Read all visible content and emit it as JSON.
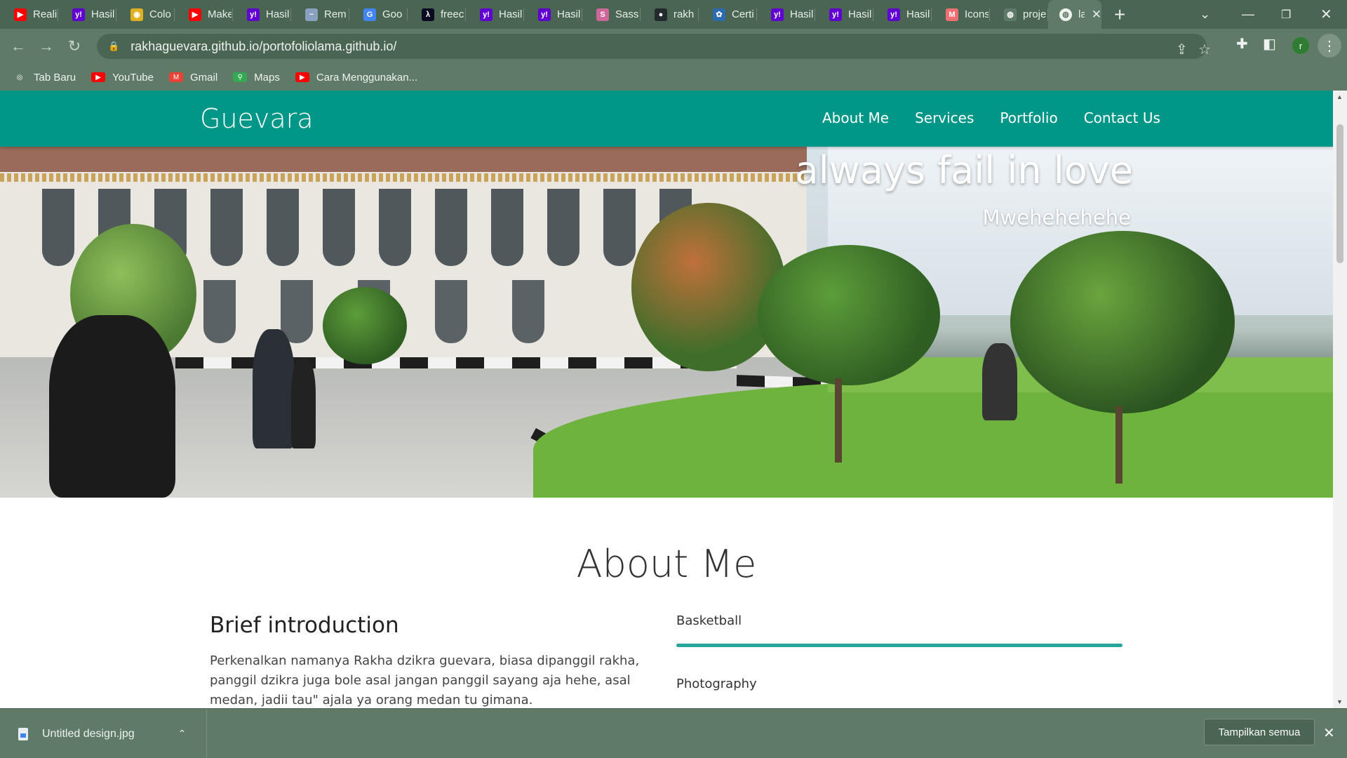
{
  "browser": {
    "tabs": [
      {
        "title": "Reali",
        "icon": "youtube-icon",
        "color": "#ff0000",
        "glyph": "▶"
      },
      {
        "title": "Hasil",
        "icon": "yahoo-icon",
        "color": "#6001d2",
        "glyph": "y!"
      },
      {
        "title": "Colo",
        "icon": "colorpicker-icon",
        "color": "#e0b020",
        "glyph": "◉"
      },
      {
        "title": "Make",
        "icon": "youtube-icon",
        "color": "#ff0000",
        "glyph": "▶"
      },
      {
        "title": "Hasil",
        "icon": "yahoo-icon",
        "color": "#6001d2",
        "glyph": "y!"
      },
      {
        "title": "Rem",
        "icon": "remove-icon",
        "color": "#8aa0c0",
        "glyph": "~"
      },
      {
        "title": "Goo",
        "icon": "google-translate-icon",
        "color": "#4285f4",
        "glyph": "G"
      },
      {
        "title": "freec",
        "icon": "freecodecamp-icon",
        "color": "#0a0a23",
        "glyph": "λ"
      },
      {
        "title": "Hasil",
        "icon": "yahoo-icon",
        "color": "#6001d2",
        "glyph": "y!"
      },
      {
        "title": "Hasil",
        "icon": "yahoo-icon",
        "color": "#6001d2",
        "glyph": "y!"
      },
      {
        "title": "Sass",
        "icon": "sass-icon",
        "color": "#cd6799",
        "glyph": "S"
      },
      {
        "title": "rakh",
        "icon": "github-icon",
        "color": "#24292e",
        "glyph": "●"
      },
      {
        "title": "Certi",
        "icon": "certificate-icon",
        "color": "#2b6cb0",
        "glyph": "✿"
      },
      {
        "title": "Hasil",
        "icon": "yahoo-icon",
        "color": "#6001d2",
        "glyph": "y!"
      },
      {
        "title": "Hasil",
        "icon": "yahoo-icon",
        "color": "#6001d2",
        "glyph": "y!"
      },
      {
        "title": "Hasil",
        "icon": "yahoo-icon",
        "color": "#6001d2",
        "glyph": "y!"
      },
      {
        "title": "Icons",
        "icon": "materialize-icon",
        "color": "#ee6e73",
        "glyph": "M"
      },
      {
        "title": "proje",
        "icon": "globe-icon",
        "color": "#5f7a66",
        "glyph": "◍"
      }
    ],
    "active_tab": {
      "title": "la",
      "icon": "globe-icon"
    },
    "url": "rakhaguevara.github.io/portofoliolama.github.io/",
    "profile_initial": "r",
    "bookmarks": [
      {
        "label": "Tab Baru",
        "icon": "chrome-icon",
        "color": "#5f7a66"
      },
      {
        "label": "YouTube",
        "icon": "youtube-icon",
        "color": "#ff0000"
      },
      {
        "label": "Gmail",
        "icon": "gmail-icon",
        "color": "#ea4335"
      },
      {
        "label": "Maps",
        "icon": "maps-icon",
        "color": "#34a853"
      },
      {
        "label": "Cara Menggunakan...",
        "icon": "youtube-icon",
        "color": "#ff0000"
      }
    ]
  },
  "site": {
    "brand": "Guevara",
    "nav": [
      "About Me",
      "Services",
      "Portfolio",
      "Contact Us"
    ],
    "hero_title": "always fail in love",
    "hero_subtitle": "Mwehehehehe",
    "about_title": "About Me",
    "intro_heading": "Brief introduction",
    "intro_text": "Perkenalkan namanya Rakha dzikra guevara, biasa dipanggil rakha, panggil dzikra juga bole asal jangan panggil sayang aja hehe, asal medan, jadii tau\" ajala ya orang medan tu gimana.",
    "skills": [
      {
        "label": "Basketball",
        "level": 1.0
      },
      {
        "label": "Photography",
        "level": null
      }
    ],
    "accent_color": "#009688"
  },
  "download_shelf": {
    "file_name": "Untitled design.jpg",
    "show_all": "Tampilkan semua"
  }
}
